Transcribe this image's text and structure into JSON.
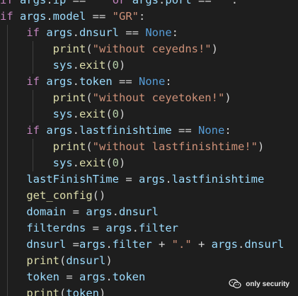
{
  "colors": {
    "background": "#1e1e1e",
    "keyword": "#c586c0",
    "variable": "#9cdcfe",
    "function": "#dcdcaa",
    "string": "#ce9178",
    "number": "#b5cea8",
    "constant": "#569cd6",
    "plain": "#d4d4d4"
  },
  "lines": [
    [
      {
        "c": "kw",
        "t": "if "
      },
      {
        "c": "var",
        "t": "args"
      },
      {
        "c": "plain",
        "t": "."
      },
      {
        "c": "var",
        "t": "ip"
      },
      {
        "c": "plain",
        "t": " == "
      },
      {
        "c": "str",
        "t": "\"\""
      },
      {
        "c": "plain",
        "t": " "
      },
      {
        "c": "kw",
        "t": "or "
      },
      {
        "c": "var",
        "t": "args"
      },
      {
        "c": "plain",
        "t": "."
      },
      {
        "c": "var",
        "t": "port"
      },
      {
        "c": "plain",
        "t": " == "
      },
      {
        "c": "str",
        "t": "\"\""
      },
      {
        "c": "plain",
        "t": ":"
      }
    ],
    [
      {
        "c": "kw",
        "t": "if "
      },
      {
        "c": "var",
        "t": "args"
      },
      {
        "c": "plain",
        "t": "."
      },
      {
        "c": "var",
        "t": "model"
      },
      {
        "c": "plain",
        "t": " == "
      },
      {
        "c": "str",
        "t": "\"GR\""
      },
      {
        "c": "plain",
        "t": ":"
      }
    ],
    [
      {
        "c": "plain",
        "t": "    "
      },
      {
        "c": "kw",
        "t": "if "
      },
      {
        "c": "var",
        "t": "args"
      },
      {
        "c": "plain",
        "t": "."
      },
      {
        "c": "var",
        "t": "dnsurl"
      },
      {
        "c": "plain",
        "t": " == "
      },
      {
        "c": "const",
        "t": "None"
      },
      {
        "c": "plain",
        "t": ":"
      }
    ],
    [
      {
        "c": "plain",
        "t": "        "
      },
      {
        "c": "fn",
        "t": "print"
      },
      {
        "c": "plain",
        "t": "("
      },
      {
        "c": "str",
        "t": "\"without ceyedns!\""
      },
      {
        "c": "plain",
        "t": ")"
      }
    ],
    [
      {
        "c": "plain",
        "t": "        "
      },
      {
        "c": "var",
        "t": "sys"
      },
      {
        "c": "plain",
        "t": "."
      },
      {
        "c": "fn",
        "t": "exit"
      },
      {
        "c": "plain",
        "t": "("
      },
      {
        "c": "num",
        "t": "0"
      },
      {
        "c": "plain",
        "t": ")"
      }
    ],
    [
      {
        "c": "plain",
        "t": "    "
      },
      {
        "c": "kw",
        "t": "if "
      },
      {
        "c": "var",
        "t": "args"
      },
      {
        "c": "plain",
        "t": "."
      },
      {
        "c": "var",
        "t": "token"
      },
      {
        "c": "plain",
        "t": " == "
      },
      {
        "c": "const",
        "t": "None"
      },
      {
        "c": "plain",
        "t": ":"
      }
    ],
    [
      {
        "c": "plain",
        "t": "        "
      },
      {
        "c": "fn",
        "t": "print"
      },
      {
        "c": "plain",
        "t": "("
      },
      {
        "c": "str",
        "t": "\"without ceyetoken!\""
      },
      {
        "c": "plain",
        "t": ")"
      }
    ],
    [
      {
        "c": "plain",
        "t": "        "
      },
      {
        "c": "var",
        "t": "sys"
      },
      {
        "c": "plain",
        "t": "."
      },
      {
        "c": "fn",
        "t": "exit"
      },
      {
        "c": "plain",
        "t": "("
      },
      {
        "c": "num",
        "t": "0"
      },
      {
        "c": "plain",
        "t": ")"
      }
    ],
    [
      {
        "c": "plain",
        "t": "    "
      },
      {
        "c": "kw",
        "t": "if "
      },
      {
        "c": "var",
        "t": "args"
      },
      {
        "c": "plain",
        "t": "."
      },
      {
        "c": "var",
        "t": "lastfinishtime"
      },
      {
        "c": "plain",
        "t": " == "
      },
      {
        "c": "const",
        "t": "None"
      },
      {
        "c": "plain",
        "t": ":"
      }
    ],
    [
      {
        "c": "plain",
        "t": "        "
      },
      {
        "c": "fn",
        "t": "print"
      },
      {
        "c": "plain",
        "t": "("
      },
      {
        "c": "str",
        "t": "\"without lastfinishtime!\""
      },
      {
        "c": "plain",
        "t": ")"
      }
    ],
    [
      {
        "c": "plain",
        "t": "        "
      },
      {
        "c": "var",
        "t": "sys"
      },
      {
        "c": "plain",
        "t": "."
      },
      {
        "c": "fn",
        "t": "exit"
      },
      {
        "c": "plain",
        "t": "("
      },
      {
        "c": "num",
        "t": "0"
      },
      {
        "c": "plain",
        "t": ")"
      }
    ],
    [
      {
        "c": "plain",
        "t": "    "
      },
      {
        "c": "var",
        "t": "lastFinishTime"
      },
      {
        "c": "plain",
        "t": " = "
      },
      {
        "c": "var",
        "t": "args"
      },
      {
        "c": "plain",
        "t": "."
      },
      {
        "c": "var",
        "t": "lastfinishtime"
      }
    ],
    [
      {
        "c": "plain",
        "t": "    "
      },
      {
        "c": "fn",
        "t": "get_config"
      },
      {
        "c": "plain",
        "t": "()"
      }
    ],
    [
      {
        "c": "plain",
        "t": "    "
      },
      {
        "c": "var",
        "t": "domain"
      },
      {
        "c": "plain",
        "t": " = "
      },
      {
        "c": "var",
        "t": "args"
      },
      {
        "c": "plain",
        "t": "."
      },
      {
        "c": "var",
        "t": "dnsurl"
      }
    ],
    [
      {
        "c": "plain",
        "t": "    "
      },
      {
        "c": "var",
        "t": "filterdns"
      },
      {
        "c": "plain",
        "t": " = "
      },
      {
        "c": "var",
        "t": "args"
      },
      {
        "c": "plain",
        "t": "."
      },
      {
        "c": "var",
        "t": "filter"
      }
    ],
    [
      {
        "c": "plain",
        "t": "    "
      },
      {
        "c": "var",
        "t": "dnsurl"
      },
      {
        "c": "plain",
        "t": " ="
      },
      {
        "c": "var",
        "t": "args"
      },
      {
        "c": "plain",
        "t": "."
      },
      {
        "c": "var",
        "t": "filter"
      },
      {
        "c": "plain",
        "t": " + "
      },
      {
        "c": "str",
        "t": "\".\""
      },
      {
        "c": "plain",
        "t": " + "
      },
      {
        "c": "var",
        "t": "args"
      },
      {
        "c": "plain",
        "t": "."
      },
      {
        "c": "var",
        "t": "dnsurl"
      }
    ],
    [
      {
        "c": "plain",
        "t": "    "
      },
      {
        "c": "fn",
        "t": "print"
      },
      {
        "c": "plain",
        "t": "("
      },
      {
        "c": "var",
        "t": "dnsurl"
      },
      {
        "c": "plain",
        "t": ")"
      }
    ],
    [
      {
        "c": "plain",
        "t": "    "
      },
      {
        "c": "var",
        "t": "token"
      },
      {
        "c": "plain",
        "t": " = "
      },
      {
        "c": "var",
        "t": "args"
      },
      {
        "c": "plain",
        "t": "."
      },
      {
        "c": "var",
        "t": "token"
      }
    ],
    [
      {
        "c": "plain",
        "t": "    "
      },
      {
        "c": "fn",
        "t": "print"
      },
      {
        "c": "plain",
        "t": "("
      },
      {
        "c": "var",
        "t": "token"
      },
      {
        "c": "plain",
        "t": ")"
      }
    ]
  ],
  "watermark": {
    "icon": "wechat-icon",
    "text": "only security"
  }
}
